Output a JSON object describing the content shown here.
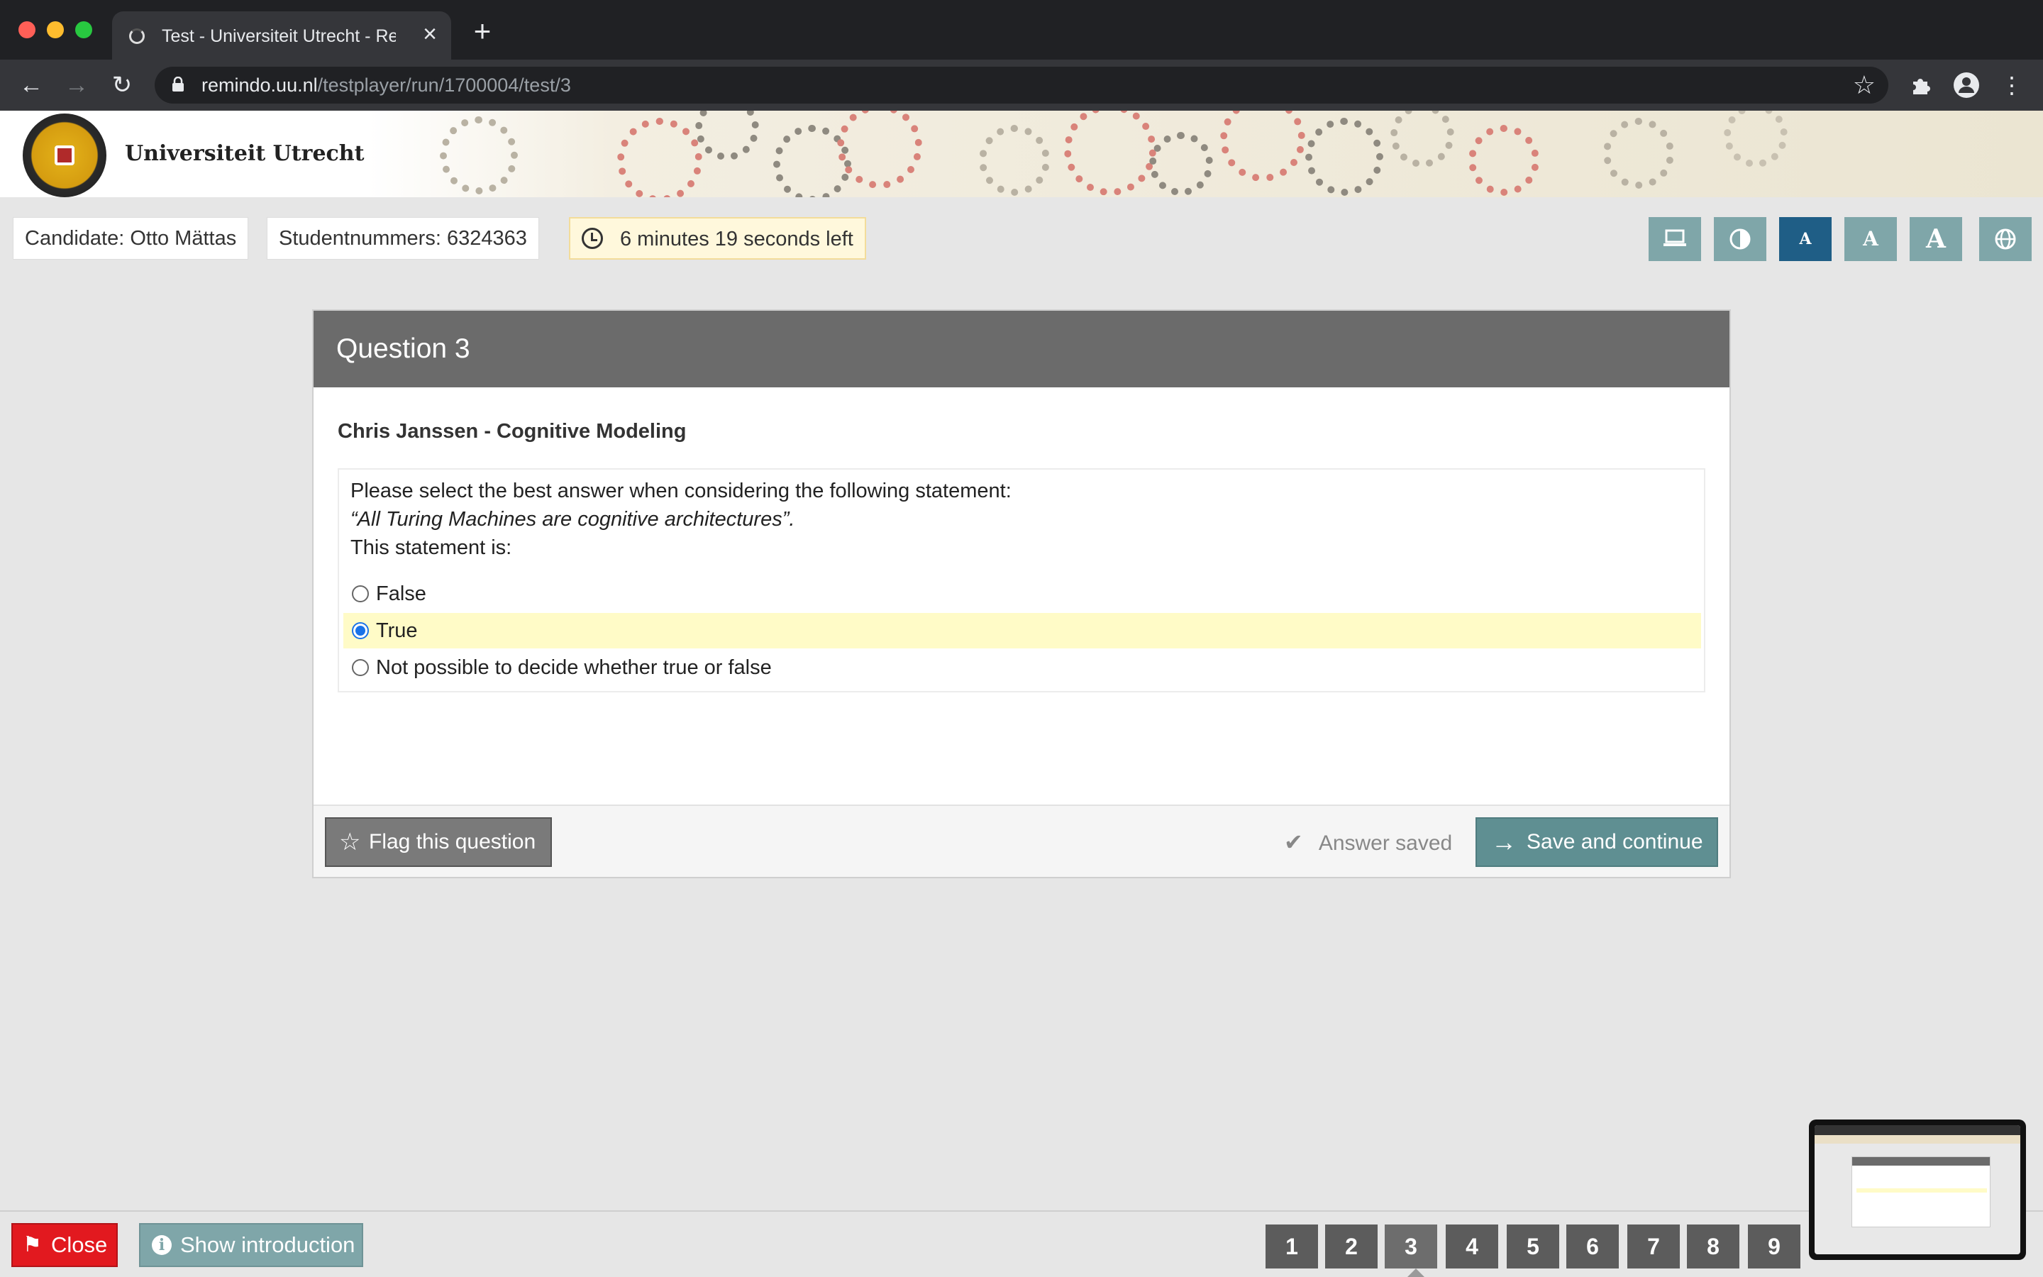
{
  "browser": {
    "tab_title": "Test - Universiteit Utrecht - Remindo",
    "url_host": "remindo.uu.nl",
    "url_path": "/testplayer/run/1700004/test/3"
  },
  "banner": {
    "university_name": "Universiteit Utrecht"
  },
  "infobar": {
    "candidate": "Candidate: Otto Mättas",
    "student_number": "Studentnummers: 6324363",
    "timer": "6 minutes 19 seconds left",
    "tools": [
      {
        "icon": "laptop-icon",
        "label": ""
      },
      {
        "icon": "contrast-icon",
        "label": ""
      },
      {
        "icon": "font-size-small-icon",
        "label": "A"
      },
      {
        "icon": "font-size-medium-icon",
        "label": "A"
      },
      {
        "icon": "font-size-large-icon",
        "label": "A"
      },
      {
        "icon": "globe-icon",
        "label": ""
      }
    ],
    "active_tool_index": 2
  },
  "question": {
    "title": "Question 3",
    "subject": "Chris Janssen - Cognitive Modeling",
    "prompt_line1": "Please select the best answer when considering the following statement:",
    "prompt_line2": "“All Turing Machines are cognitive architectures”.",
    "prompt_line3": "This statement is:",
    "options": [
      {
        "label": "False",
        "selected": false
      },
      {
        "label": "True",
        "selected": true
      },
      {
        "label": "Not possible to decide whether true or false",
        "selected": false
      }
    ],
    "flag_label": "Flag this question",
    "saved_status": "Answer saved",
    "save_label": "Save and continue"
  },
  "bottombar": {
    "close_label": "Close",
    "intro_label": "Show introduction",
    "question_numbers": [
      "1",
      "2",
      "3",
      "4",
      "5",
      "6",
      "7",
      "8",
      "9"
    ],
    "current_question": "3"
  },
  "colors": {
    "accent_teal": "#7fa6a9",
    "active_tool": "#1f5e86",
    "close_red": "#e2191f",
    "selected_option": "#fffbc7",
    "timer_bg": "#fff8dc"
  }
}
